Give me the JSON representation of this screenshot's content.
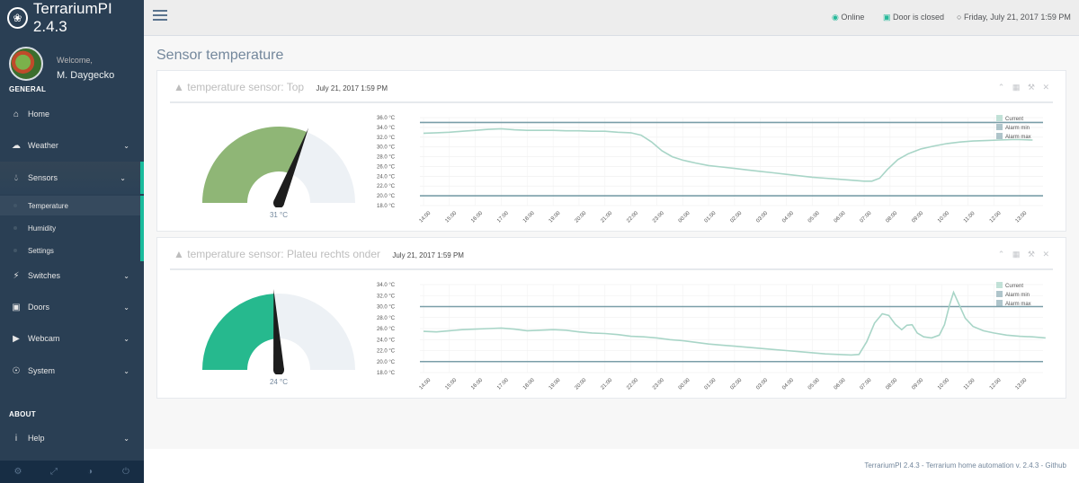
{
  "app": {
    "title": "TerrariumPI 2.4.3"
  },
  "profile": {
    "welcome": "Welcome,",
    "name": "M. Daygecko"
  },
  "sidebar": {
    "general_title": "GENERAL",
    "about_title": "ABOUT",
    "items": [
      {
        "label": "Home",
        "icon": "home-icon"
      },
      {
        "label": "Weather",
        "icon": "cloud-icon"
      },
      {
        "label": "Sensors",
        "icon": "drop-icon"
      },
      {
        "label": "Switches",
        "icon": "bolt-icon"
      },
      {
        "label": "Doors",
        "icon": "lock-icon"
      },
      {
        "label": "Webcam",
        "icon": "camera-icon"
      },
      {
        "label": "System",
        "icon": "bulb-icon"
      },
      {
        "label": "Help",
        "icon": "info-icon"
      }
    ],
    "sensor_subitems": [
      {
        "label": "Temperature"
      },
      {
        "label": "Humidity"
      },
      {
        "label": "Settings"
      }
    ],
    "footer_icons": [
      "gear-icon",
      "fullscreen-icon",
      "eye-slash-icon",
      "power-icon"
    ]
  },
  "topbar": {
    "online": "Online",
    "door": "Door is closed",
    "datetime": "Friday, July 21, 2017 1:59 PM"
  },
  "page": {
    "title": "Sensor temperature"
  },
  "panels": [
    {
      "title": "temperature sensor: Top",
      "timestamp": "July 21, 2017 1:59 PM",
      "gauge": {
        "value_label": "31 °C",
        "value": 31,
        "min": 0,
        "max": 50,
        "fill_color": "#8FB676",
        "track_color": "#EDF1F5"
      },
      "chart_data": {
        "type": "line",
        "y_ticks": [
          "36.0 °C",
          "34.0 °C",
          "32.0 °C",
          "30.0 °C",
          "28.0 °C",
          "26.0 °C",
          "24.0 °C",
          "22.0 °C",
          "20.0 °C",
          "18.0 °C"
        ],
        "ylim": [
          18,
          36
        ],
        "x_ticks": [
          "14:00",
          "15:00",
          "16:00",
          "17:00",
          "18:00",
          "19:00",
          "20:00",
          "21:00",
          "22:00",
          "23:00",
          "00:00",
          "01:00",
          "02:00",
          "03:00",
          "04:00",
          "05:00",
          "06:00",
          "07:00",
          "08:00",
          "09:00",
          "10:00",
          "11:00",
          "12:00",
          "13:00"
        ],
        "legend": [
          "Current",
          "Alarm min",
          "Alarm max"
        ],
        "alarm_min": 20,
        "alarm_max": 35,
        "current": [
          [
            0,
            32.8
          ],
          [
            0.5,
            32.9
          ],
          [
            1,
            33
          ],
          [
            1.5,
            33.2
          ],
          [
            2,
            33.4
          ],
          [
            2.5,
            33.6
          ],
          [
            3,
            33.7
          ],
          [
            3.5,
            33.5
          ],
          [
            4,
            33.4
          ],
          [
            4.5,
            33.4
          ],
          [
            5,
            33.4
          ],
          [
            5.5,
            33.3
          ],
          [
            6,
            33.3
          ],
          [
            6.5,
            33.2
          ],
          [
            7,
            33.2
          ],
          [
            7.5,
            33
          ],
          [
            8,
            32.9
          ],
          [
            8.4,
            32.4
          ],
          [
            8.8,
            31
          ],
          [
            9.2,
            29.2
          ],
          [
            9.6,
            28
          ],
          [
            10,
            27.3
          ],
          [
            10.5,
            26.7
          ],
          [
            11,
            26.2
          ],
          [
            11.5,
            25.9
          ],
          [
            12,
            25.6
          ],
          [
            12.5,
            25.3
          ],
          [
            13,
            25
          ],
          [
            13.5,
            24.7
          ],
          [
            14,
            24.4
          ],
          [
            14.5,
            24.1
          ],
          [
            15,
            23.8
          ],
          [
            15.5,
            23.6
          ],
          [
            16,
            23.4
          ],
          [
            16.5,
            23.2
          ],
          [
            17,
            23
          ],
          [
            17.3,
            23
          ],
          [
            17.6,
            23.6
          ],
          [
            17.9,
            25.4
          ],
          [
            18.3,
            27.4
          ],
          [
            18.7,
            28.6
          ],
          [
            19.2,
            29.6
          ],
          [
            19.7,
            30.2
          ],
          [
            20.2,
            30.7
          ],
          [
            20.7,
            31
          ],
          [
            21.2,
            31.2
          ],
          [
            21.7,
            31.3
          ],
          [
            22.2,
            31.4
          ],
          [
            22.7,
            31.5
          ],
          [
            23,
            31.5
          ],
          [
            23.5,
            31.4
          ]
        ],
        "line_color": "#A8D5C7",
        "alarm_color": "#7A9EA8"
      }
    },
    {
      "title": "temperature sensor: Plateu rechts onder",
      "timestamp": "July 21, 2017 1:59 PM",
      "gauge": {
        "value_label": "24 °C",
        "value": 24,
        "min": 0,
        "max": 50,
        "fill_color": "#26B98E",
        "track_color": "#EDF1F5"
      },
      "chart_data": {
        "type": "line",
        "y_ticks": [
          "34.0 °C",
          "32.0 °C",
          "30.0 °C",
          "28.0 °C",
          "26.0 °C",
          "24.0 °C",
          "22.0 °C",
          "20.0 °C",
          "18.0 °C"
        ],
        "ylim": [
          18,
          34
        ],
        "x_ticks": [
          "14:00",
          "15:00",
          "16:00",
          "17:00",
          "18:00",
          "19:00",
          "20:00",
          "21:00",
          "22:00",
          "23:00",
          "00:00",
          "01:00",
          "02:00",
          "03:00",
          "04:00",
          "05:00",
          "06:00",
          "07:00",
          "08:00",
          "09:00",
          "10:00",
          "11:00",
          "12:00",
          "13:00"
        ],
        "legend": [
          "Current",
          "Alarm min",
          "Alarm max"
        ],
        "alarm_min": 20,
        "alarm_max": 30,
        "current": [
          [
            0,
            25.5
          ],
          [
            0.5,
            25.4
          ],
          [
            1,
            25.6
          ],
          [
            1.5,
            25.8
          ],
          [
            2,
            25.9
          ],
          [
            2.5,
            26
          ],
          [
            3,
            26.1
          ],
          [
            3.5,
            25.9
          ],
          [
            4,
            25.6
          ],
          [
            4.5,
            25.7
          ],
          [
            5,
            25.8
          ],
          [
            5.5,
            25.7
          ],
          [
            6,
            25.4
          ],
          [
            6.5,
            25.2
          ],
          [
            7,
            25.1
          ],
          [
            7.5,
            24.9
          ],
          [
            8,
            24.6
          ],
          [
            8.5,
            24.5
          ],
          [
            9,
            24.3
          ],
          [
            9.5,
            24
          ],
          [
            10,
            23.8
          ],
          [
            10.5,
            23.5
          ],
          [
            11,
            23.2
          ],
          [
            11.5,
            23
          ],
          [
            12,
            22.8
          ],
          [
            12.5,
            22.6
          ],
          [
            13,
            22.4
          ],
          [
            13.5,
            22.2
          ],
          [
            14,
            22
          ],
          [
            14.5,
            21.8
          ],
          [
            15,
            21.6
          ],
          [
            15.5,
            21.4
          ],
          [
            16,
            21.3
          ],
          [
            16.5,
            21.2
          ],
          [
            16.8,
            21.3
          ],
          [
            17.1,
            23.6
          ],
          [
            17.4,
            27
          ],
          [
            17.7,
            28.7
          ],
          [
            17.95,
            28.4
          ],
          [
            18.2,
            26.8
          ],
          [
            18.45,
            25.8
          ],
          [
            18.65,
            26.6
          ],
          [
            18.85,
            26.7
          ],
          [
            19.05,
            25.2
          ],
          [
            19.3,
            24.5
          ],
          [
            19.6,
            24.3
          ],
          [
            19.9,
            24.8
          ],
          [
            20.1,
            26.7
          ],
          [
            20.3,
            30.4
          ],
          [
            20.45,
            32.6
          ],
          [
            20.65,
            30.5
          ],
          [
            20.9,
            27.9
          ],
          [
            21.2,
            26.4
          ],
          [
            21.6,
            25.6
          ],
          [
            22,
            25.2
          ],
          [
            22.5,
            24.8
          ],
          [
            23,
            24.6
          ],
          [
            23.5,
            24.5
          ],
          [
            24,
            24.3
          ]
        ],
        "line_color": "#A8D5C7",
        "alarm_color": "#7A9EA8"
      }
    }
  ],
  "footer": {
    "text": "TerrariumPI 2.4.3 - Terrarium home automation v. 2.4.3 - Github"
  }
}
